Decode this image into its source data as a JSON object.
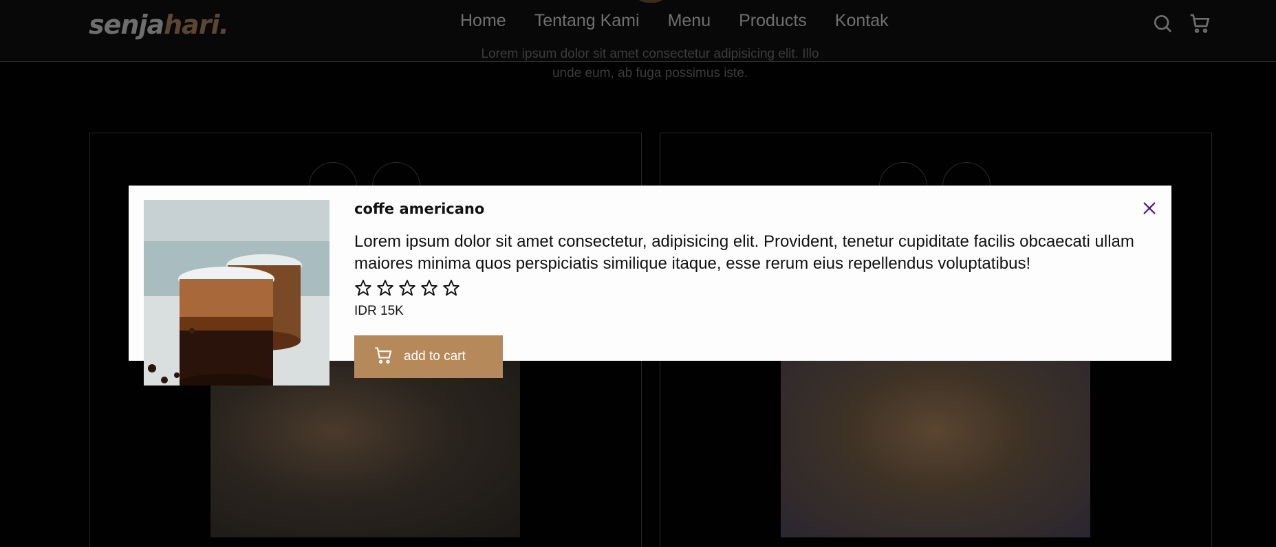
{
  "brand": {
    "part1": "senja",
    "part2": "hari",
    "dot": "."
  },
  "nav": {
    "items": [
      "Home",
      "Tentang Kami",
      "Menu",
      "Products",
      "Kontak"
    ]
  },
  "icons": {
    "search": "search-icon",
    "cart": "cart-icon"
  },
  "section": {
    "subtitle": "Lorem ipsum dolor sit amet consectetur adipisicing elit. Illo unde eum, ab fuga possimus iste."
  },
  "modal": {
    "title": "coffe americano",
    "description": "Lorem ipsum dolor sit amet consectetur, adipisicing elit. Provident, tenetur cupiditate facilis obcaecati ullam maiores minima quos perspiciatis similique itaque, esse rerum eius repellendus voluptatibus!",
    "rating": {
      "filled": 0,
      "total": 5
    },
    "price": "IDR 15K",
    "cart_label": "add to cart"
  },
  "colors": {
    "accent": "#b6895b",
    "close": "#4b1a8c"
  }
}
